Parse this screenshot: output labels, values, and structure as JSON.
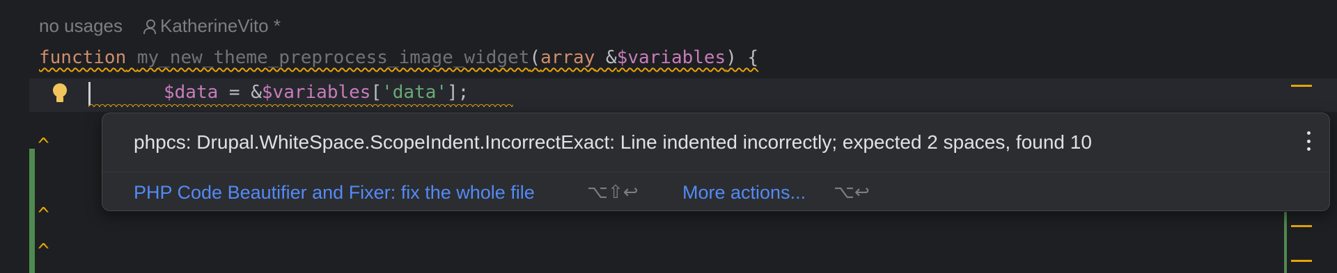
{
  "inlay_hints": {
    "usages": "no usages",
    "author": "KatherineVito *"
  },
  "code": {
    "line1": {
      "keyword": "function",
      "function_name": "my_new_theme_preprocess_image_widget",
      "open_paren": "(",
      "type_hint": "array",
      "ampersand": " &",
      "param": "$variables",
      "close": ") {"
    },
    "line2": {
      "var": "$data",
      "assign": " = &",
      "var2": "$variables",
      "open_bracket": "[",
      "string": "'data'",
      "close": "];"
    }
  },
  "colors": {
    "keyword": "#cf8e6d",
    "variable": "#c77dbb",
    "string": "#6aab73",
    "warning": "#e5a50a",
    "link": "#548af7"
  },
  "popup": {
    "message": "phpcs: Drupal.WhiteSpace.ScopeIndent.IncorrectExact: Line indented incorrectly; expected 2 spaces, found 10",
    "actions": [
      {
        "label": "PHP Code Beautifier and Fixer: fix the whole file",
        "shortcut": "⌥⇧↩"
      },
      {
        "label": "More actions...",
        "shortcut": "⌥↩"
      }
    ]
  },
  "gutter_marks": {
    "caret": "^"
  },
  "icons": [
    "user-icon",
    "lightbulb-icon",
    "more-vertical-icon"
  ]
}
